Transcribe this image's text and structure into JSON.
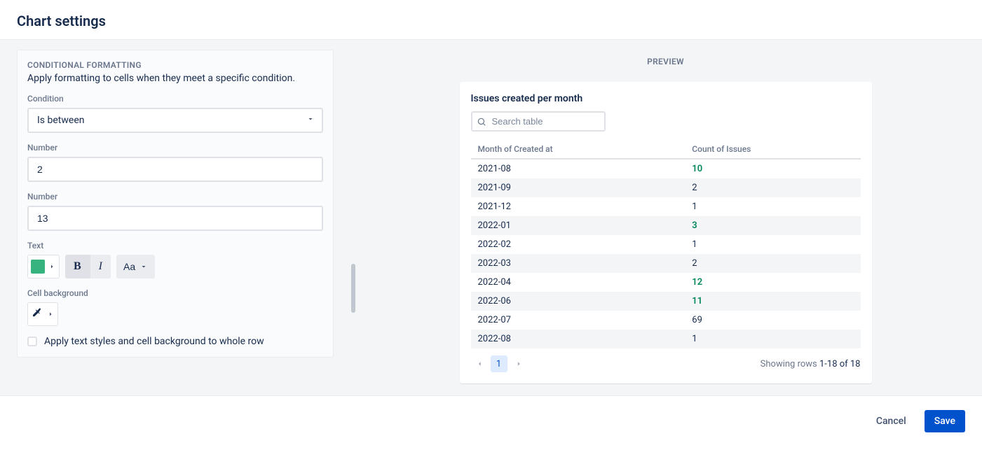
{
  "header": {
    "title": "Chart settings"
  },
  "form": {
    "section_label": "CONDITIONAL FORMATTING",
    "section_desc": "Apply formatting to cells when they meet a specific condition.",
    "condition_label": "Condition",
    "condition_value": "Is between",
    "number1_label": "Number",
    "number1_value": "2",
    "number2_label": "Number",
    "number2_value": "13",
    "text_label": "Text",
    "text_color": "#36B37E",
    "case_label": "Aa",
    "cellbg_label": "Cell background",
    "apply_row_label": "Apply text styles and cell background to whole row"
  },
  "preview": {
    "label": "PREVIEW",
    "title": "Issues created per month",
    "search_placeholder": "Search table",
    "col1": "Month of Created at",
    "col2": "Count of Issues",
    "rows": [
      {
        "month": "2021-08",
        "count": "10",
        "hl": true
      },
      {
        "month": "2021-09",
        "count": "2",
        "hl": false
      },
      {
        "month": "2021-12",
        "count": "1",
        "hl": false
      },
      {
        "month": "2022-01",
        "count": "3",
        "hl": true
      },
      {
        "month": "2022-02",
        "count": "1",
        "hl": false
      },
      {
        "month": "2022-03",
        "count": "2",
        "hl": false
      },
      {
        "month": "2022-04",
        "count": "12",
        "hl": true
      },
      {
        "month": "2022-06",
        "count": "11",
        "hl": true
      },
      {
        "month": "2022-07",
        "count": "69",
        "hl": false
      },
      {
        "month": "2022-08",
        "count": "1",
        "hl": false
      }
    ],
    "page": "1",
    "rows_label": "Showing rows ",
    "rows_range": "1-18 of 18"
  },
  "footer": {
    "cancel": "Cancel",
    "save": "Save"
  },
  "chart_data": {
    "type": "table",
    "title": "Issues created per month",
    "columns": [
      "Month of Created at",
      "Count of Issues"
    ],
    "rows": [
      [
        "2021-08",
        10
      ],
      [
        "2021-09",
        2
      ],
      [
        "2021-12",
        1
      ],
      [
        "2022-01",
        3
      ],
      [
        "2022-02",
        1
      ],
      [
        "2022-03",
        2
      ],
      [
        "2022-04",
        12
      ],
      [
        "2022-06",
        11
      ],
      [
        "2022-07",
        69
      ],
      [
        "2022-08",
        1
      ]
    ]
  }
}
